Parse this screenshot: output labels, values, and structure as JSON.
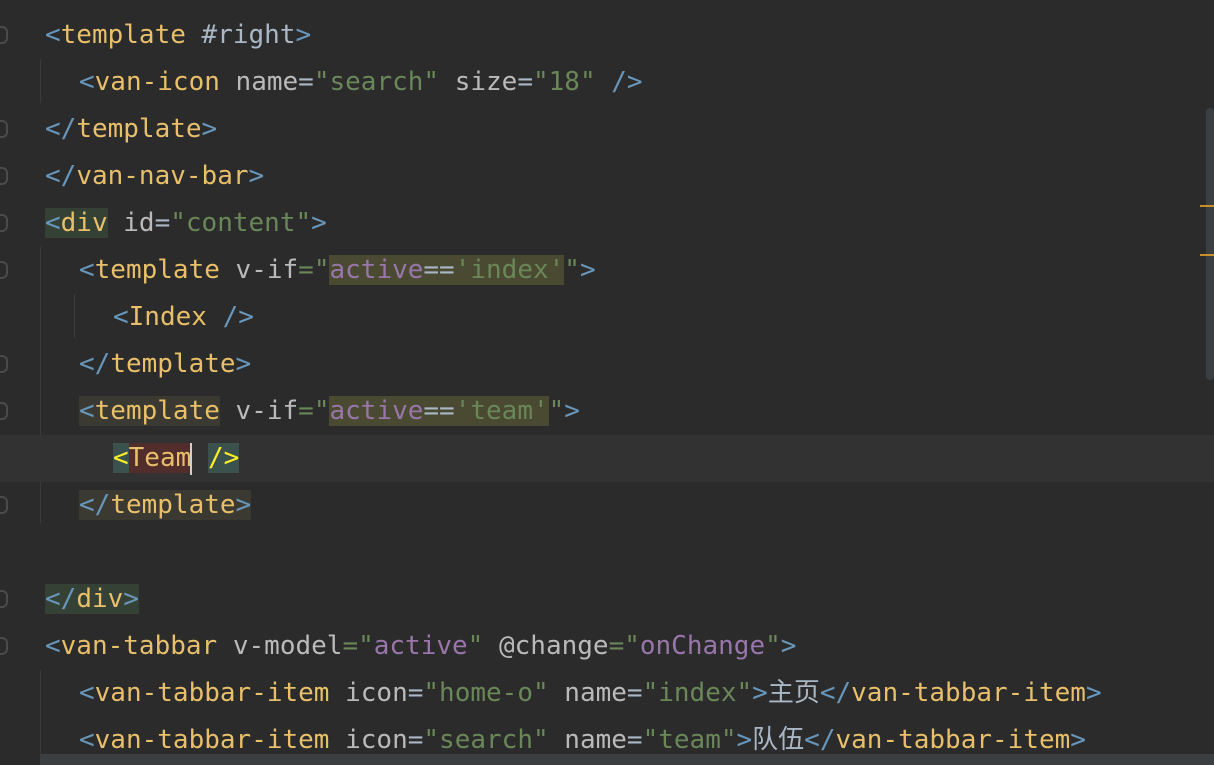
{
  "editor": {
    "line_template_right": {
      "open": "<",
      "tag": "template",
      "attr": " #right",
      "close": ">"
    },
    "line_van_icon": {
      "open": "<",
      "tag": "van-icon",
      "attr1": " name",
      "eq1": "=",
      "val1": "\"search\"",
      "attr2": " size",
      "eq2": "=",
      "val2": "\"18\"",
      "close": " />"
    },
    "line_template_close1": {
      "open": "</",
      "tag": "template",
      "close": ">"
    },
    "line_nav_bar_close": {
      "open": "</",
      "tag": "van-nav-bar",
      "close": ">"
    },
    "line_div_open": {
      "open": "<",
      "tag": "div",
      "attr": " id",
      "eq": "=",
      "val": "\"content\"",
      "close": ">"
    },
    "line_template_index": {
      "open": "<",
      "tag": "template",
      "attr": " v-if",
      "eq": "=\"",
      "expr_var": "active",
      "expr_op": "==",
      "expr_str": "'index'",
      "quote": "\"",
      "close": ">"
    },
    "line_index_comp": {
      "open": "<",
      "tag": "Index",
      "close": " />"
    },
    "line_template_close2": {
      "open": "</",
      "tag": "template",
      "close": ">"
    },
    "line_template_team": {
      "open": "<",
      "tag": "template",
      "attr": " v-if",
      "eq": "=\"",
      "expr_var": "active",
      "expr_op": "==",
      "expr_str": "'team'",
      "quote": "\"",
      "close": ">"
    },
    "line_team_comp": {
      "open": "<",
      "tag": "Team",
      "space": " ",
      "close": "/>"
    },
    "line_template_close3": {
      "open": "</",
      "tag": "template",
      "close": ">"
    },
    "line_div_close": {
      "open": "</",
      "tag": "div",
      "close": ">"
    },
    "line_tabbar": {
      "open": "<",
      "tag": "van-tabbar",
      "attr1": " v-model",
      "eq1": "=\"",
      "val1": "active",
      "q1": "\"",
      "attr2": " @change",
      "eq2": "=\"",
      "val2": "onChange",
      "q2": "\"",
      "close": ">"
    },
    "line_tabbar_item1": {
      "open": "<",
      "tag": "van-tabbar-item",
      "attr1": " icon",
      "eq1": "=",
      "val1": "\"home-o\"",
      "attr2": " name",
      "eq2": "=",
      "val2": "\"index\"",
      "close": ">",
      "text": "主页",
      "end_open": "</",
      "end_tag": "van-tabbar-item",
      "end_close": ">"
    },
    "line_tabbar_item2": {
      "open": "<",
      "tag": "van-tabbar-item",
      "attr1": " icon",
      "eq1": "=",
      "val1": "\"search\"",
      "attr2": " name",
      "eq2": "=",
      "val2": "\"team\"",
      "close": ">",
      "text": "队伍",
      "end_open": "</",
      "end_tag": "van-tabbar-item",
      "end_close": ">"
    }
  },
  "colors": {
    "background": "#2b2b2b",
    "tag": "#e8bf6a",
    "punctuation": "#6897bb",
    "string": "#6a8759",
    "vue_expression": "#9876aa",
    "attribute": "#bababa",
    "matched_tag": "#ffef28"
  }
}
